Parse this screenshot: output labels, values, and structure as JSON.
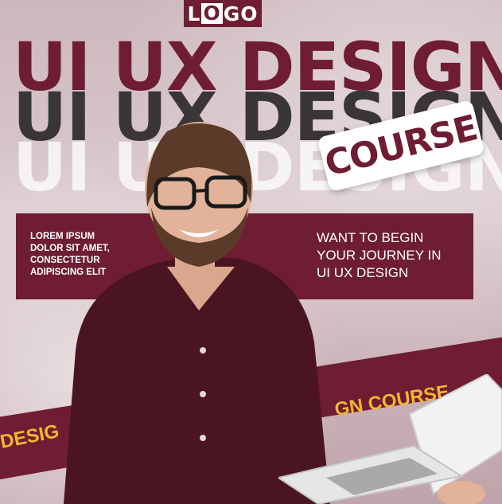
{
  "logo": {
    "pre": "L",
    "o": "O",
    "post": "GO"
  },
  "headline": {
    "line1": "UI UX DESIGN",
    "line2": "UI UX DESIGN",
    "line3": "UI UX DESIGN"
  },
  "badge": {
    "text": "COURSE"
  },
  "info_left": [
    "LOREM IPSUM",
    "DOLOR SIT AMET,",
    "CONSECTETUR",
    "ADIPISCING ELIT"
  ],
  "info_right": [
    "WANT TO BEGIN",
    "YOUR JOURNEY IN",
    "UI UX DESIGN"
  ],
  "ribbon": {
    "right": "GN COURSE",
    "left": "DESIG"
  },
  "colors": {
    "brand": "#6e1d33",
    "accent": "#f2b632",
    "background": "#d9c9cd"
  }
}
